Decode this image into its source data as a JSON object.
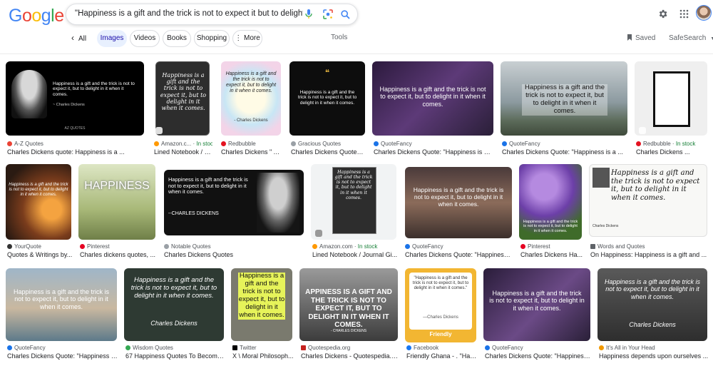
{
  "search": {
    "query": "\"Happiness is a gift and the trick is not to expect it but to delight in it when it",
    "clear_label": "×"
  },
  "logo": [
    "G",
    "o",
    "o",
    "g",
    "l",
    "e"
  ],
  "logo_colors": [
    "#4285F4",
    "#EA4335",
    "#FBBC05",
    "#4285F4",
    "#34A853",
    "#EA4335"
  ],
  "tabs": {
    "all": "All",
    "images": "Images",
    "videos": "Videos",
    "books": "Books",
    "shopping": "Shopping",
    "more": "More",
    "tools": "Tools",
    "saved": "Saved",
    "safesearch": "SafeSearch"
  },
  "results": [
    {
      "source": "A-Z Quotes",
      "title": "Charles Dickens quote: Happiness is a ...",
      "quote": "Happiness is a gift and the trick is not to expect it, but to delight in it when it comes.",
      "attribution": "~ Charles Dickens",
      "footer": "AZ QUOTES"
    },
    {
      "source": "Amazon.c...",
      "stock": "In stock",
      "title": "Lined Notebook / J...",
      "quote": "Happiness is a gift and the trick is not to expect it, but to delight in it when it comes."
    },
    {
      "source": "Redbubble",
      "title": "Charles Dickens \" A...",
      "quote": "Happiness is a gift and the trick is not to expect it, but to delight in it when it comes.",
      "attribution": "- Charles Dickens"
    },
    {
      "source": "Gracious Quotes",
      "title": "Charles Dickens Quotes ...",
      "quote": "Happiness is a gift and the trick is not to expect it, but to delight in it when it comes."
    },
    {
      "source": "QuoteFancy",
      "title": "Charles Dickens Quote: \"Happiness is a ...",
      "quote": "Happiness is a gift and the trick is not to expect it, but to delight in it when it comes."
    },
    {
      "source": "QuoteFancy",
      "title": "Charles Dickens Quote: \"Happiness is a ...",
      "quote": "Happiness is a gift and the trick is not to expect it, but to delight in it when it comes."
    },
    {
      "source": "Redbubble",
      "stock": "In stock",
      "title": "Charles Dickens ..."
    },
    {
      "source": "YourQuote",
      "title": "Quotes & Writings by...",
      "quote": "Happiness is a gift and the trick is not to expect it, but to delight in it when it comes."
    },
    {
      "source": "Pinterest",
      "title": "Charles dickens quotes, ...",
      "quote": "HAPPINESS"
    },
    {
      "source": "Notable Quotes",
      "title": "Charles Dickens Quotes",
      "quote": "Happiness is a gift and the trick is not to expect it, but to delight in it when it comes.",
      "attribution": "--CHARLES DICKENS"
    },
    {
      "source": "Amazon.com",
      "stock": "In stock",
      "title": "Lined Notebook / Journal Gi...",
      "quote": "Happiness is a gift and the trick is not to expect it, but to delight in it when it comes."
    },
    {
      "source": "QuoteFancy",
      "title": "Charles Dickens Quote: \"Happiness i...",
      "quote": "Happiness is a gift and the trick is not to expect it, but to delight in it when it comes."
    },
    {
      "source": "Pinterest",
      "title": "Charles Dickens Ha...",
      "quote": "Happiness is a gift and the trick is not to expect it, but to delight in it when it comes."
    },
    {
      "source": "Words and Quotes",
      "title": "On Happiness: Happiness is a gift and ...",
      "quote": "Happiness is a gift and the trick is not to expect it, but to delight in it when it comes.",
      "attribution": "Charles Dickens"
    },
    {
      "source": "QuoteFancy",
      "title": "Charles Dickens Quote: \"Happiness is...",
      "quote": "Happiness is a gift and the trick is not to expect it, but to delight in it when it comes."
    },
    {
      "source": "Wisdom Quotes",
      "title": "67 Happiness Quotes To Become...",
      "quote": "Happiness is a gift and the trick is not to expect it, but to delight in it when it comes.",
      "attribution": "Charles Dickens"
    },
    {
      "source": "Twitter",
      "title": "X \\ Moral Philosoph...",
      "quote": "Happiness is a gift and the trick is not to expect it, but to delight in it when it comes."
    },
    {
      "source": "Quotespedia.org",
      "title": "Charles Dickens - Quotespedia.org",
      "quote": "APPINESS IS A GIFT AND THE TRICK IS NOT TO EXPECT IT, BUT TO DELIGHT IN IT WHEN IT COMES.",
      "attribution": "- CHARLES DICKENS"
    },
    {
      "source": "Facebook",
      "title": "Friendly Ghana - . \"Hap...",
      "quote": "\"Happiness is a gift and the trick is not to expect it, but to delight in it when it comes.\"",
      "attribution": "—Charles Dickens",
      "footer": "Friendly"
    },
    {
      "source": "QuoteFancy",
      "title": "Charles Dickens Quote: \"Happiness i...",
      "quote": "Happiness is a gift and the trick is not to expect it, but to delight in it when it comes."
    },
    {
      "source": "It's All in Your Head",
      "title": "Happiness depends upon ourselves ...",
      "quote": "Happiness is a gift and the trick is not to expect it, but to delight in it when it comes.",
      "attribution": "Charles Dickens"
    }
  ],
  "colors": {
    "accent": "#1a73e8",
    "stock_green": "#188038",
    "active_tab_bg": "#e8f0fe"
  }
}
